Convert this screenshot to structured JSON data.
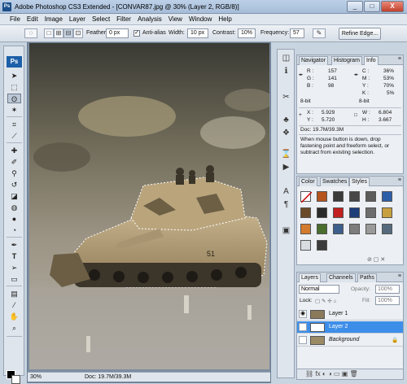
{
  "window": {
    "title": "Adobe Photoshop CS3 Extended - [CONVAR87.jpg @ 30% (Layer 2, RGB/8)]",
    "app_badge": "Ps",
    "controls": [
      "_",
      "□",
      "X"
    ]
  },
  "menu": [
    "File",
    "Edit",
    "Image",
    "Layer",
    "Select",
    "Filter",
    "Analysis",
    "View",
    "Window",
    "Help"
  ],
  "options": {
    "feather_label": "Feather:",
    "feather_value": "0 px",
    "antialias_label": "Anti-alias",
    "antialias_checked": true,
    "width_label": "Width:",
    "width_value": "10 px",
    "contrast_label": "Contrast:",
    "contrast_value": "10%",
    "frequency_label": "Frequency:",
    "frequency_value": "57",
    "refine_edge_label": "Refine Edge..."
  },
  "toolbox": {
    "logo": "Ps",
    "tools": [
      "move",
      "marquee",
      "magnetic-lasso",
      "magic-wand",
      "crop",
      "slice",
      "healing",
      "brush",
      "clone-stamp",
      "history-brush",
      "eraser",
      "gradient",
      "blur",
      "dodge",
      "pen",
      "type",
      "path-select",
      "shape",
      "notes",
      "eyedropper",
      "hand",
      "zoom"
    ]
  },
  "document": {
    "zoom": "30%",
    "doc_size": "Doc: 19.7M/39.3M"
  },
  "info_panel": {
    "tabs": [
      "Navigator",
      "Histogram",
      "Info"
    ],
    "active_tab": "Info",
    "r_label": "R :",
    "r_value": "157",
    "g_label": "G :",
    "g_value": "141",
    "b_label": "B :",
    "b_value": "98",
    "c_label": "C :",
    "c_value": "36%",
    "m_label": "M :",
    "m_value": "53%",
    "y_label": "Y :",
    "y_value": "70%",
    "k_label": "K :",
    "k_value": "5%",
    "bit_left": "8-bit",
    "bit_right": "8-bit",
    "x_label": "X :",
    "x_value": "5.929",
    "yc_label": "Y :",
    "yc_value": "5.720",
    "w_label": "W :",
    "w_value": "6.804",
    "h_label": "H :",
    "h_value": "3.667",
    "doc": "Doc: 19.7M/39.3M",
    "hint": "When mouse button is down, drop fastening point and freeform select, or subtract from existing selection."
  },
  "styles_panel": {
    "tabs": [
      "Color",
      "Swatches",
      "Styles"
    ],
    "active_tab": "Styles",
    "swatch_colors": [
      "#ffffff",
      "#b5541d",
      "#3a3a3a",
      "#474747",
      "#5c5c5c",
      "#2d5fa8",
      "#6b4a2a",
      "#2a2a2a",
      "#c21f1f",
      "#1e3e7a",
      "#6d6d6d",
      "#c8a040",
      "#d47a2e",
      "#4a6e2e",
      "#3d5f8c",
      "#7d7d7d",
      "#9a9a9a",
      "#556b7d",
      "#d9dde2",
      "#3b3b3b"
    ]
  },
  "layers_panel": {
    "tabs": [
      "Layers",
      "Channels",
      "Paths"
    ],
    "active_tab": "Layers",
    "blend_mode": "Normal",
    "opacity_label": "Opacity:",
    "opacity_value": "100%",
    "lock_label": "Lock:",
    "fill_label": "Fill:",
    "fill_value": "100%",
    "layers": [
      {
        "name": "Layer 1",
        "visible": true,
        "selected": false,
        "thumb": "#8a7a5a"
      },
      {
        "name": "Layer 2",
        "visible": false,
        "selected": true,
        "thumb": "#ffffff"
      },
      {
        "name": "Background",
        "visible": false,
        "selected": false,
        "thumb": "#9b8a66",
        "locked": true
      }
    ]
  }
}
